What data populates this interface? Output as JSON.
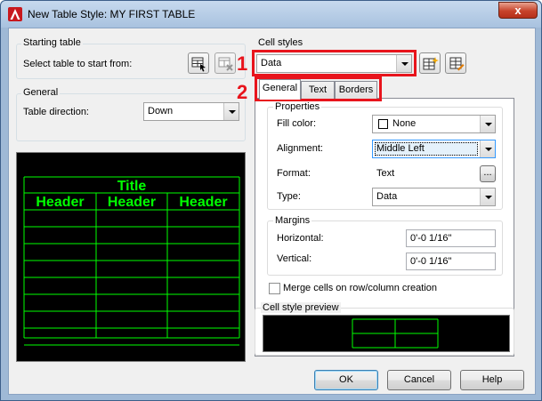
{
  "window": {
    "title": "New Table Style: MY FIRST TABLE",
    "close_label": "x"
  },
  "starting_table": {
    "group_label": "Starting table",
    "select_label": "Select table to start from:"
  },
  "general": {
    "group_label": "General",
    "direction_label": "Table direction:",
    "direction_value": "Down"
  },
  "cell_styles": {
    "label": "Cell styles",
    "value": "Data",
    "callouts": [
      "1",
      "2"
    ]
  },
  "tabs": [
    {
      "label": "General",
      "active": true
    },
    {
      "label": "Text",
      "active": false
    },
    {
      "label": "Borders",
      "active": false
    }
  ],
  "properties": {
    "group_label": "Properties",
    "fill_color_label": "Fill color:",
    "fill_color_value": "None",
    "alignment_label": "Alignment:",
    "alignment_value": "Middle Left",
    "format_label": "Format:",
    "format_value": "Text",
    "format_button": "...",
    "type_label": "Type:",
    "type_value": "Data"
  },
  "margins": {
    "group_label": "Margins",
    "horizontal_label": "Horizontal:",
    "horizontal_value": "0'-0 1/16\"",
    "vertical_label": "Vertical:",
    "vertical_value": "0'-0 1/16\""
  },
  "merge_label": "Merge cells on row/column creation",
  "preview": {
    "group_label": "Cell style preview",
    "table_title": "Title",
    "headers": [
      "Header",
      "Header",
      "Header"
    ],
    "line_color": "#00ff00"
  },
  "buttons": {
    "ok": "OK",
    "cancel": "Cancel",
    "help": "Help"
  }
}
